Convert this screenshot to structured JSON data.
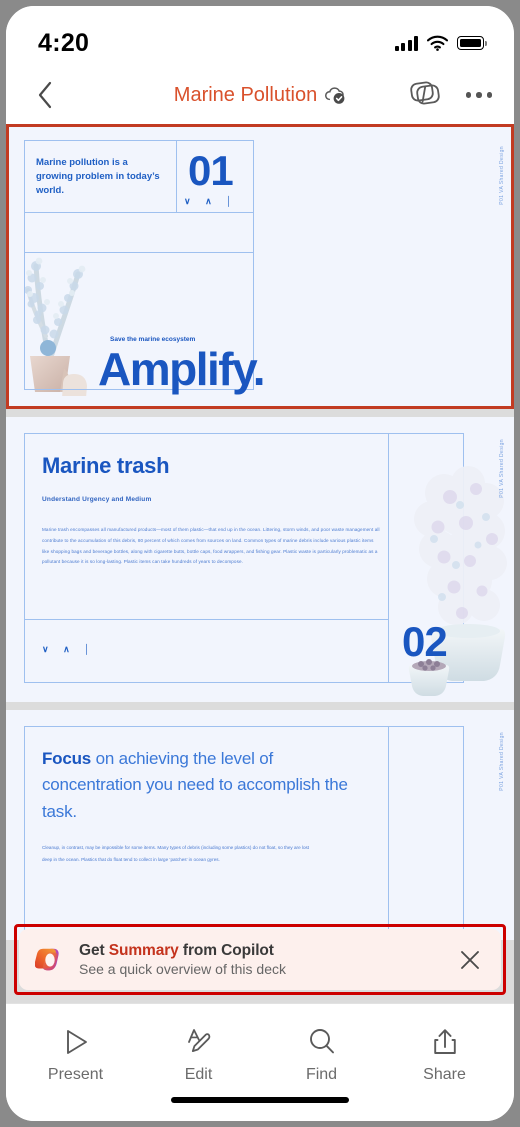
{
  "status_bar": {
    "time": "4:20",
    "icons": [
      "cellular-signal-icon",
      "wifi-icon",
      "battery-icon"
    ]
  },
  "nav_bar": {
    "back_icon": "chevron-left-icon",
    "title": "Marine Pollution",
    "sync_icon": "cloud-check-icon",
    "slides_icon": "slide-layers-icon",
    "more_icon": "more-options-icon",
    "title_color": "#d9512c"
  },
  "deck": {
    "selection_color": "#c23b22",
    "accent_blue": "#1a56c0",
    "slide_bg": "#f2f5fd",
    "slides": [
      {
        "selected": true,
        "number": "01",
        "lead": "Marine pollution is a growing problem in today’s world.",
        "nav_glyphs": "∨ ∧ │",
        "tagline": "Save the marine ecosystem",
        "wordmark": "Amplify.",
        "vertical_label": "P01  VA Shared Design"
      },
      {
        "selected": false,
        "number": "02",
        "title": "Marine trash",
        "subtitle": "Understand Urgency and Medium",
        "body": "Marine trash encompasses all manufactured products—most of them plastic—that end up in the ocean. Littering, storm winds, and poor waste management all contribute to the accumulation of this debris, 80 percent of which comes from sources on land. Common types of marine debris include various plastic items like shopping bags and beverage bottles, along with cigarette butts, bottle caps, food wrappers, and fishing gear. Plastic waste is particularly problematic as a pollutant because it is so long-lasting. Plastic items can take hundreds of years to decompose.",
        "nav_glyphs": "∨ ∧ │",
        "vertical_label": "P01  VA Shared Design"
      },
      {
        "selected": false,
        "title_bold": "Focus",
        "title_rest": " on achieving the level of concentration you need to accomplish the task.",
        "body": "Cleanup, in contrast, may be impossible for some items. Many types of debris (including some plastics) do not float, so they are lost deep in the ocean. Plastics that do float tend to collect in large ‘patches’ in ocean gyres.",
        "vertical_label": "P01  VA Shared Design"
      }
    ]
  },
  "copilot_banner": {
    "selected": true,
    "selection_color": "#cc0000",
    "logo_icon": "copilot-logo-icon",
    "title_prefix": "Get ",
    "title_highlight": "Summary",
    "title_suffix": " from Copilot",
    "subtitle": "See a quick overview of this deck",
    "close_icon": "close-icon",
    "background": "#fdf0ed",
    "highlight_color": "#c4331d"
  },
  "tab_bar": {
    "tabs": [
      {
        "label": "Present",
        "icon": "play-triangle-icon"
      },
      {
        "label": "Edit",
        "icon": "pen-edit-icon"
      },
      {
        "label": "Find",
        "icon": "search-icon"
      },
      {
        "label": "Share",
        "icon": "share-upload-icon"
      }
    ]
  }
}
